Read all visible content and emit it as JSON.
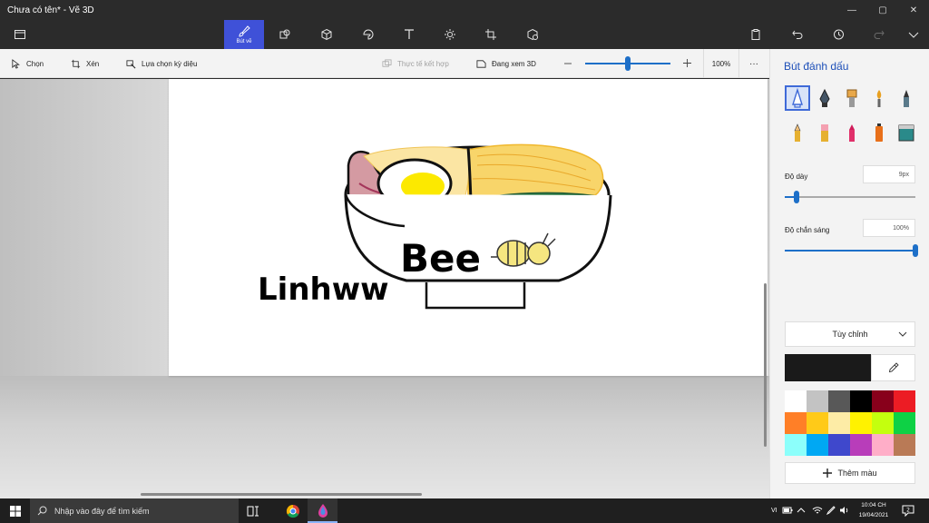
{
  "window": {
    "title": "Chưa có tên* - Vẽ 3D",
    "min": "—",
    "max": "▢",
    "close": "✕"
  },
  "main_toolbar": {
    "active_label": "Bút vẽ",
    "colors": {
      "active": "#3f51d8",
      "bg": "#2b2b2b"
    }
  },
  "sub_toolbar": {
    "select": "Chọn",
    "crop": "Xén",
    "magic_select": "Lựa chọn kỳ diệu",
    "mixed_reality": "Thực tế kết hợp",
    "view_3d": "Đang xem 3D",
    "zoom": "100%",
    "zoom_level_fraction": 0.5,
    "more": "···"
  },
  "canvas_art": {
    "bee_text": "Bee",
    "signature": "Linhww"
  },
  "panel": {
    "title": "Bút đánh dấu",
    "thickness_label": "Độ dày",
    "thickness_value": "9px",
    "thickness_fraction": 0.09,
    "opacity_label": "Độ chắn sáng",
    "opacity_value": "100%",
    "opacity_fraction": 1.0,
    "dropdown": "Tùy chỉnh",
    "add_color": "Thêm màu",
    "current_color": "#1a1a1a",
    "palette": [
      "#ffffff",
      "#c3c3c3",
      "#585858",
      "#000000",
      "#88001b",
      "#ec1c24",
      "#ff7f27",
      "#ffca18",
      "#fdeca6",
      "#fff200",
      "#c4ff0e",
      "#0ed145",
      "#8cfffb",
      "#00a8f3",
      "#3f48cc",
      "#b83dba",
      "#ffaec8",
      "#b97a56"
    ]
  },
  "taskbar": {
    "search_placeholder": "Nhập vào đây để tìm kiếm",
    "lang": "VI",
    "time": "10:04 CH",
    "date": "19/04/2021",
    "notif_count": "2"
  }
}
